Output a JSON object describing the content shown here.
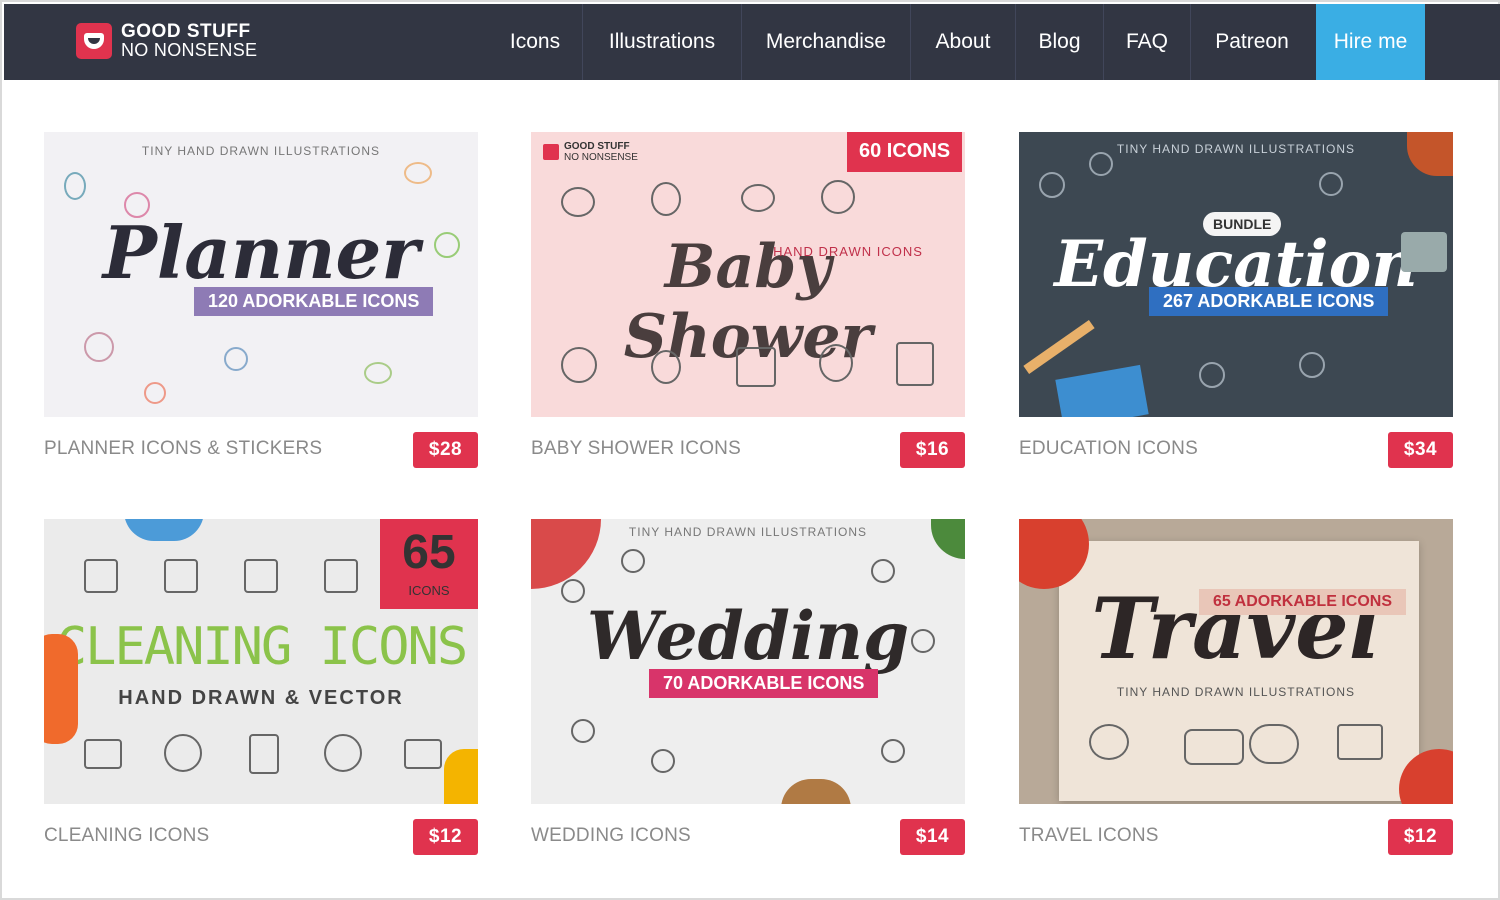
{
  "brand": {
    "line1": "GOOD STUFF",
    "line2": "NO NONSENSE"
  },
  "nav": {
    "items": [
      "Icons",
      "Illustrations",
      "Merchandise",
      "About",
      "Blog",
      "FAQ",
      "Patreon"
    ],
    "hire": "Hire me"
  },
  "colors": {
    "nav_bg": "#323643",
    "hire_bg": "#3aaee4",
    "price_bg": "#e0334e"
  },
  "products": [
    {
      "name": "PLANNER ICONS & STICKERS",
      "price": "$28",
      "art_title": "Planner",
      "art_sub": "TINY HAND DRAWN ILLUSTRATIONS",
      "art_badge": "120 ADORKABLE ICONS"
    },
    {
      "name": "BABY SHOWER ICONS",
      "price": "$16",
      "art_title": "Baby Shower",
      "art_sub": "HAND DRAWN ICONS",
      "art_badge": "60 ICONS",
      "art_brand1": "GOOD STUFF",
      "art_brand2": "NO NONSENSE"
    },
    {
      "name": "EDUCATION ICONS",
      "price": "$34",
      "art_title": "Education",
      "art_sub": "TINY HAND DRAWN ILLUSTRATIONS",
      "art_badge": "267 ADORKABLE ICONS",
      "art_tag": "BUNDLE"
    },
    {
      "name": "CLEANING ICONS",
      "price": "$12",
      "art_title": "CLEANING ICONS",
      "art_sub": "HAND DRAWN & VECTOR",
      "art_badge": "65",
      "art_badge_sub": "ICONS"
    },
    {
      "name": "WEDDING ICONS",
      "price": "$14",
      "art_title": "Wedding",
      "art_sub": "TINY HAND DRAWN ILLUSTRATIONS",
      "art_badge": "70 ADORKABLE ICONS"
    },
    {
      "name": "TRAVEL ICONS",
      "price": "$12",
      "art_title": "Travel",
      "art_sub": "TINY HAND DRAWN ILLUSTRATIONS",
      "art_badge": "65 ADORKABLE ICONS"
    }
  ]
}
